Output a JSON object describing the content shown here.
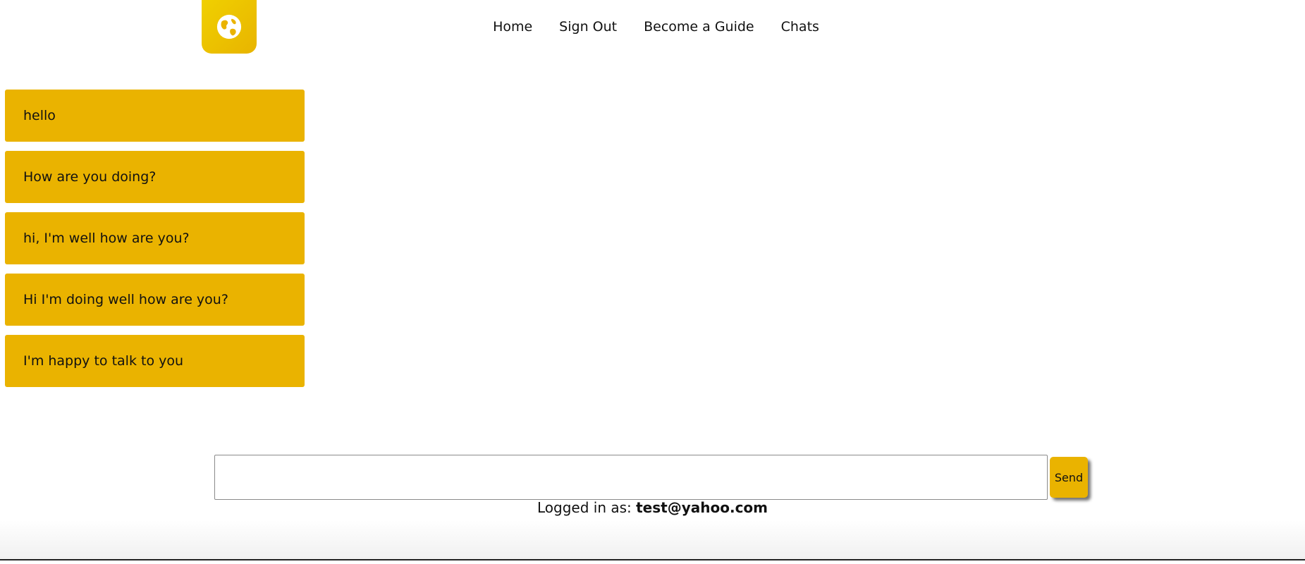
{
  "header": {
    "logo_icon": "globe-icon",
    "accent_color": "#eab300"
  },
  "nav": {
    "items": [
      {
        "label": "Home"
      },
      {
        "label": "Sign Out"
      },
      {
        "label": "Become a Guide"
      },
      {
        "label": "Chats"
      }
    ]
  },
  "messages": [
    {
      "text": "hello"
    },
    {
      "text": "How are you doing?"
    },
    {
      "text": "hi, I'm well how are you?"
    },
    {
      "text": "Hi I'm doing well how are you?"
    },
    {
      "text": "I'm happy to talk to you"
    }
  ],
  "composer": {
    "value": "",
    "placeholder": "",
    "send_label": "Send"
  },
  "status": {
    "prefix": "Logged in as: ",
    "user": "test@yahoo.com"
  }
}
